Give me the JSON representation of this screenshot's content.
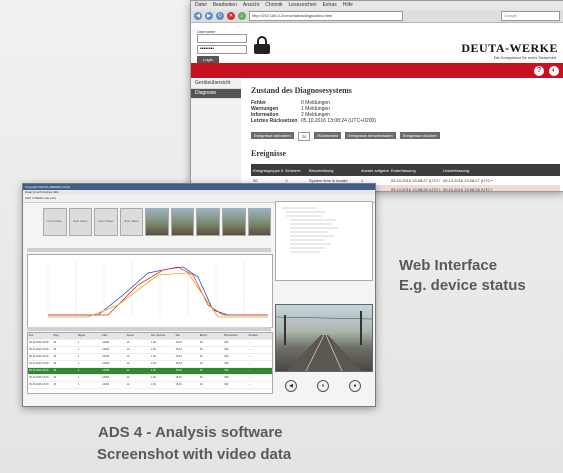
{
  "captions": {
    "web_title": "Web Interface",
    "web_sub": "E.g. device status",
    "ads_title": "ADS 4 - Analysis software",
    "ads_sub": "Screenshot with video data"
  },
  "browser": {
    "menu": [
      "Datei",
      "Bearbeiten",
      "Ansicht",
      "Chronik",
      "Lesezeichen",
      "Extras",
      "Hilfe"
    ],
    "url": "http://192.168.0.2/cms/statusdiagnostics.html",
    "search_placeholder": "Google",
    "login": {
      "username_label": "Username",
      "password_value": "••••••••",
      "login_button": "Login"
    },
    "logo": "DEUTA-WERKE",
    "logo_sub": "Die Kompetenz für mehr Sicherheit",
    "help_icon": "?",
    "sidebar": [
      "Geräteübersicht",
      "Diagnose"
    ],
    "heading": "Zustand des Diagnosesystems",
    "status": [
      {
        "k": "Fehler",
        "v": "0 Meldungen"
      },
      {
        "k": "Warnungen",
        "v": "1 Meldungen"
      },
      {
        "k": "Information",
        "v": "2 Meldungen"
      },
      {
        "k": "Letztes Rücksetzen",
        "v": "05.10.2016 13:08:24 (UTC+0200)"
      }
    ],
    "buttons": [
      "Ereignisse anfordern",
      "20",
      "Rücksetzen",
      "Ereignisse herunterladen",
      "Ereignisse drucken"
    ],
    "events_title": "Ereignisse",
    "event_columns": [
      "Ereignisgruppe ID",
      "Schwere",
      "Beschreibung",
      "Anzahl aufgetreten",
      "Ersterfassung",
      "Letzterfassung"
    ],
    "event_rows": [
      [
        "00",
        "⚠",
        "System time is invalid",
        "1",
        "05.10.2016 13:08:27 (UTC+0200)",
        "05.10.2016 13:08:27 (UTC+0200)"
      ],
      [
        "00",
        "ⓘ",
        "Logging startup",
        "1",
        "05.10.2016 13:08:28 (UTC+0200)",
        "05.10.2016 13:08:28 (UTC+0200)"
      ],
      [
        "00",
        "ⓘ",
        "",
        "1",
        "05.10.2016 13:08:24 (UTC+0200)",
        "05.10.2016 13:08:24 (UTC+0200)"
      ]
    ]
  },
  "ads": {
    "title": "Copyright DEUTA-WERKE GmbH",
    "menu": "Datei  Ansicht  Extras  Hilfe",
    "toolbar": "ADS 4 DEMO.ads (ser)",
    "thumb_labels": [
      "Kein Video",
      "Kein Video",
      "Kein Video",
      "Kein Video",
      "",
      "",
      "",
      "",
      ""
    ],
    "chart_series_colors": [
      "#1f4fd0",
      "#e23a1c",
      "#e8a21a"
    ],
    "table_columns": [
      "Zeit",
      "Weg",
      "Signal",
      "Fahr",
      "Speed",
      "Akt. Geschw.",
      "Soll",
      "Brems",
      "Bremsdruck",
      "Zustand"
    ],
    "table_rows": [
      [
        "05.10.2016 13:08",
        "34",
        "1",
        "12300",
        "12",
        "1,00",
        "15,00",
        "30",
        "360",
        "--"
      ],
      [
        "05.10.2016 13:08",
        "34",
        "1",
        "12300",
        "12",
        "1,00",
        "15,00",
        "30",
        "360",
        "--"
      ],
      [
        "05.10.2016 13:08",
        "34",
        "1",
        "12300",
        "12",
        "1,00",
        "15,00",
        "30",
        "360",
        "--"
      ],
      [
        "05.10.2016 13:08",
        "34",
        "1",
        "12300",
        "12",
        "1,00",
        "15,00",
        "30",
        "360",
        "--"
      ],
      [
        "05.10.2016 13:08",
        "34",
        "1",
        "12300",
        "12",
        "1,00",
        "15,00",
        "30",
        "360",
        "--"
      ],
      [
        "05.10.2016 13:08",
        "34",
        "1",
        "12300",
        "12",
        "1,00",
        "15,00",
        "30",
        "360",
        "--"
      ],
      [
        "05.10.2016 13:08",
        "34",
        "1",
        "12300",
        "12",
        "1,00",
        "15,00",
        "30",
        "360",
        "--"
      ]
    ],
    "video_buttons": [
      "◀",
      "⏸",
      "●"
    ]
  }
}
